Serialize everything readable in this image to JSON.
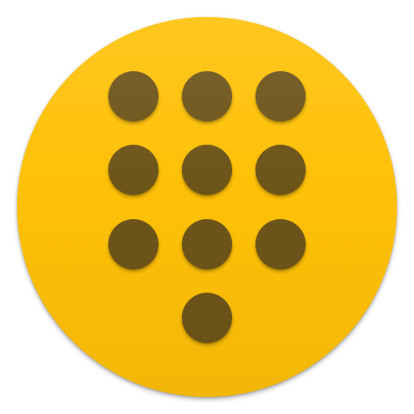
{
  "icon": {
    "name": "dialpad-app-icon",
    "background_color": "#FFC107",
    "dot_color": "#6D5419",
    "dots": [
      {
        "name": "dialpad-key-1"
      },
      {
        "name": "dialpad-key-2"
      },
      {
        "name": "dialpad-key-3"
      },
      {
        "name": "dialpad-key-4"
      },
      {
        "name": "dialpad-key-5"
      },
      {
        "name": "dialpad-key-6"
      },
      {
        "name": "dialpad-key-7"
      },
      {
        "name": "dialpad-key-8"
      },
      {
        "name": "dialpad-key-9"
      },
      {
        "name": "dialpad-key-0"
      }
    ]
  }
}
